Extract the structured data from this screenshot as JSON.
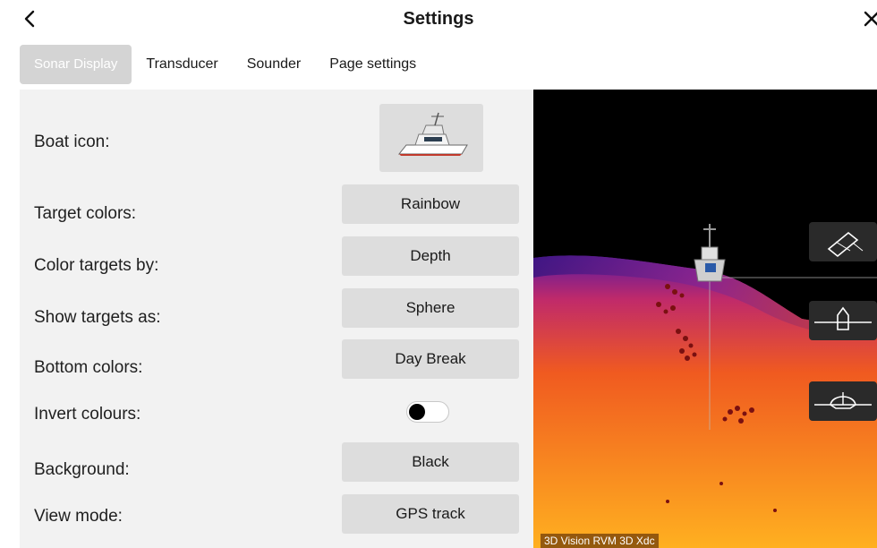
{
  "header": {
    "title": "Settings"
  },
  "tabs": [
    {
      "label": "Sonar Display",
      "active": true
    },
    {
      "label": "Transducer",
      "active": false
    },
    {
      "label": "Sounder",
      "active": false
    },
    {
      "label": "Page settings",
      "active": false
    }
  ],
  "settings": {
    "boat_icon_label": "Boat icon:",
    "rows": [
      {
        "label": "Target colors:",
        "value": "Rainbow"
      },
      {
        "label": "Color targets by:",
        "value": "Depth"
      },
      {
        "label": "Show targets as:",
        "value": "Sphere"
      },
      {
        "label": "Bottom colors:",
        "value": "Day Break"
      },
      {
        "label": "Background:",
        "value": "Black"
      },
      {
        "label": "View mode:",
        "value": "GPS track"
      }
    ],
    "invert": {
      "label": "Invert colours:",
      "on": false
    }
  },
  "preview": {
    "caption": "3D Vision RVM 3D Xdc",
    "view_buttons": [
      "perspective-view-icon",
      "side-view-icon",
      "front-view-icon"
    ]
  },
  "colors": {
    "tab_active_bg": "#d4d4d4",
    "panel_bg": "#f2f2f2",
    "button_bg": "#dddddd"
  }
}
